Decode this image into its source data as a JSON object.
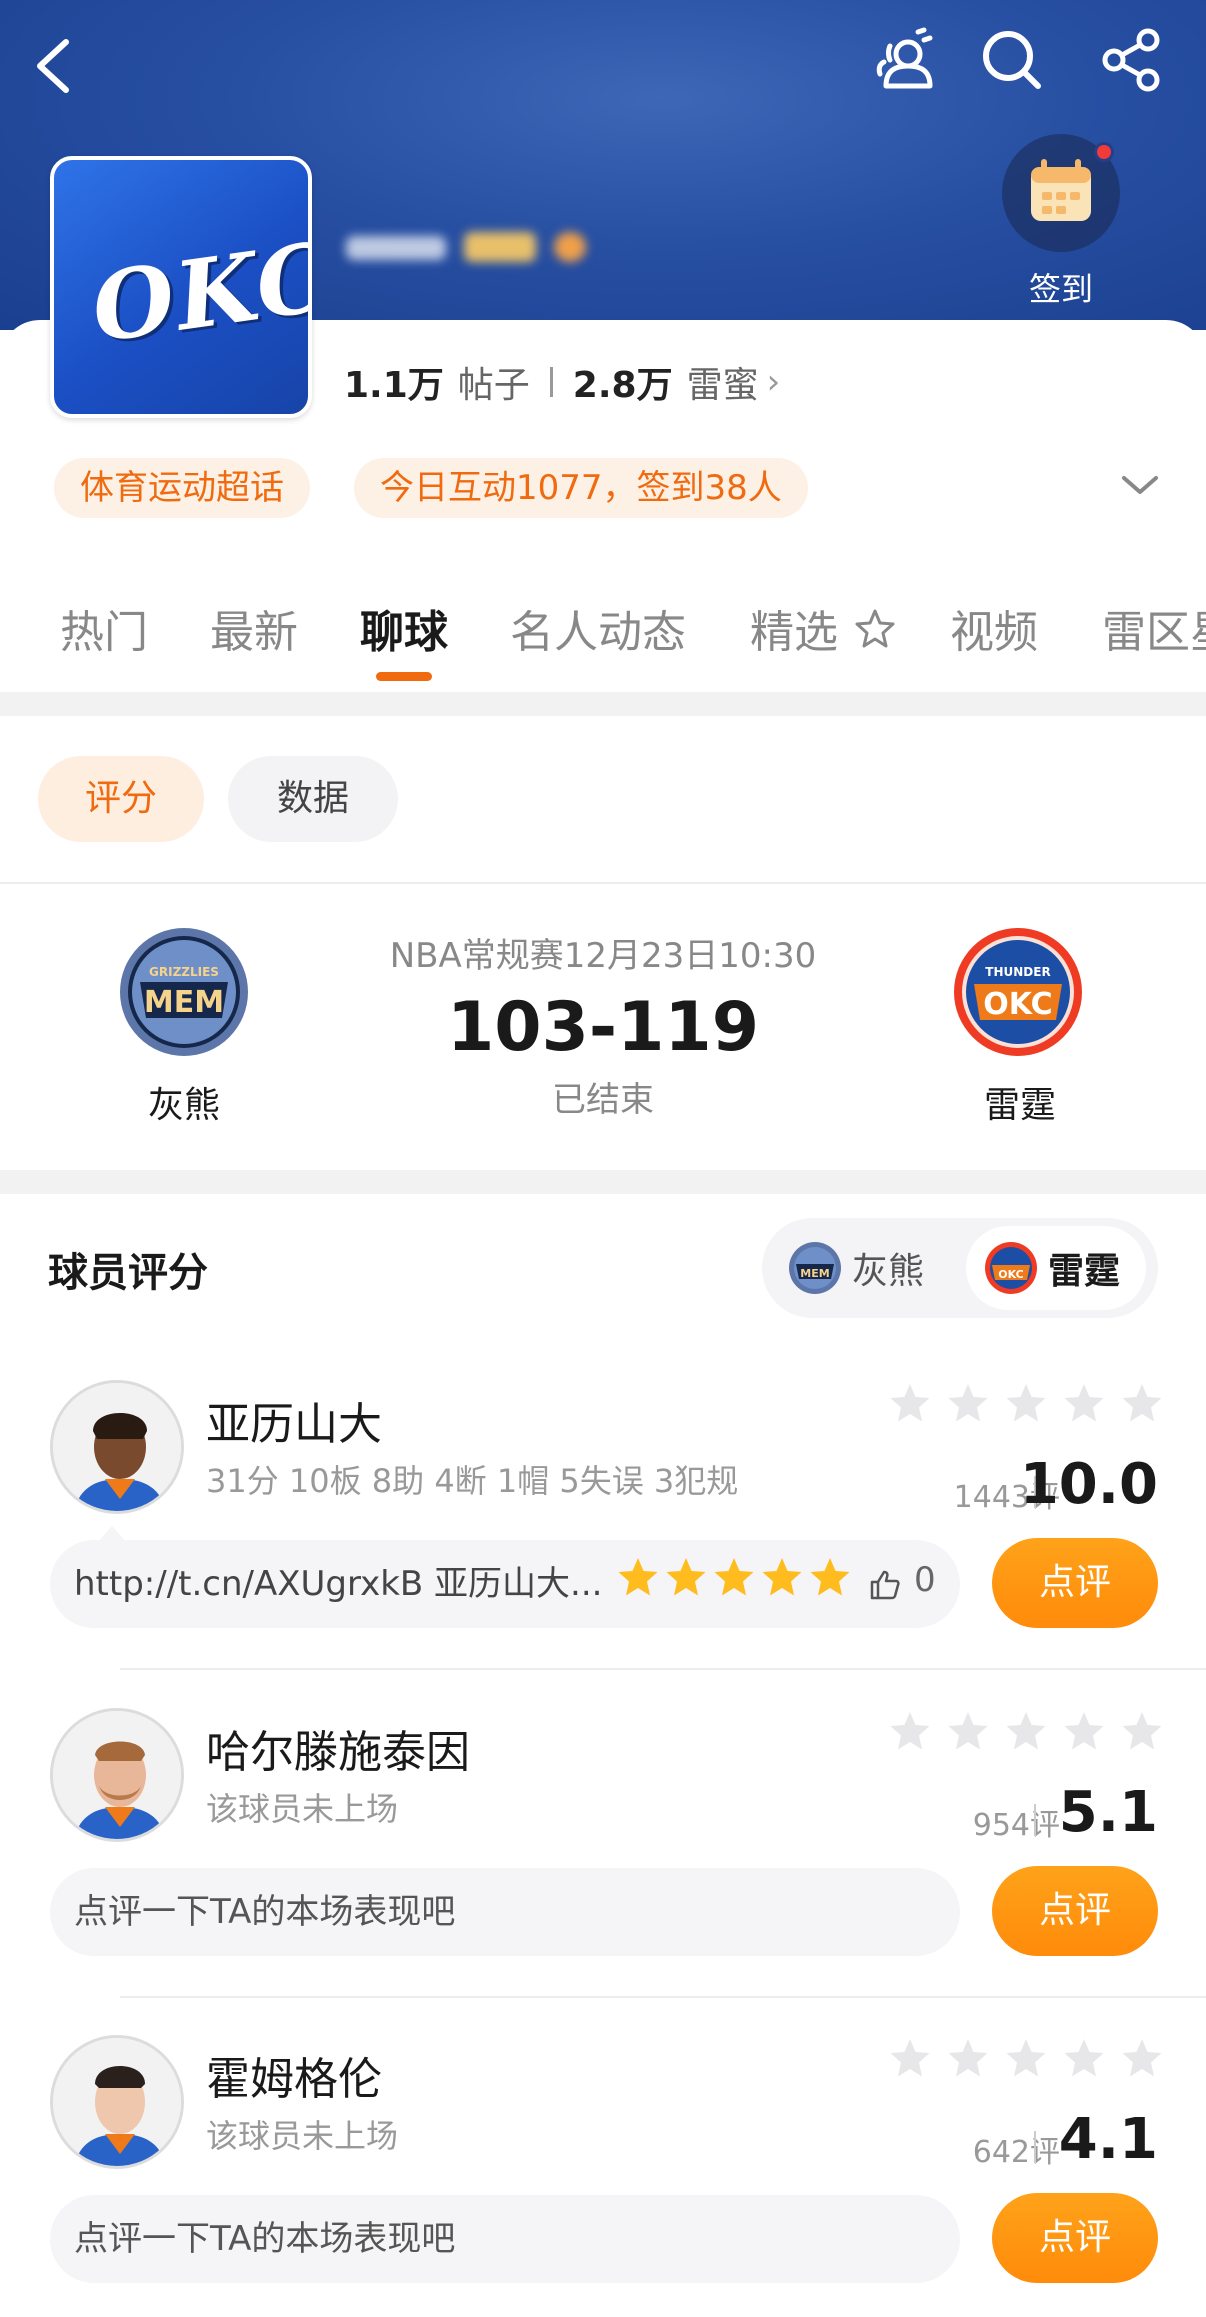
{
  "header": {
    "checkin_label": "签到"
  },
  "stats": {
    "posts_count": "1.1万",
    "posts_label": "帖子",
    "fans_count": "2.8万",
    "fans_label": "雷蜜"
  },
  "tags": {
    "category": "体育运动超话",
    "activity": "今日互动1077，签到38人"
  },
  "tabs": [
    "热门",
    "最新",
    "聊球",
    "名人动态",
    "精选",
    "视频",
    "雷区星"
  ],
  "subtabs": [
    "评分",
    "数据"
  ],
  "match": {
    "info": "NBA常规赛12月23日10:30",
    "score": "103-119",
    "status": "已结束",
    "home": {
      "name": "灰熊",
      "logo_text": "MEM",
      "logo_top": "GRIZZLIES",
      "color": "#5d76a9"
    },
    "away": {
      "name": "雷霆",
      "logo_text": "OKC",
      "logo_top": "THUNDER",
      "color": "#ef3b24"
    }
  },
  "ratings": {
    "title": "球员评分",
    "team_options": [
      "灰熊",
      "雷霆"
    ],
    "selected_team": "雷霆",
    "players": [
      {
        "name": "亚历山大",
        "stats": "31分 10板 8助 4断 1帽 5失误 3犯规",
        "count": "1443评",
        "score": "10.0",
        "comment": "http://t.cn/AXUgrxkB 亚历山大...",
        "comment_stars": 5,
        "likes": "0",
        "button": "点评"
      },
      {
        "name": "哈尔滕施泰因",
        "stats": "该球员未上场",
        "count": "954评",
        "score": "5.1",
        "comment": "点评一下TA的本场表现吧",
        "button": "点评"
      },
      {
        "name": "霍姆格伦",
        "stats": "该球员未上场",
        "count": "642评",
        "score": "4.1",
        "comment": "点评一下TA的本场表现吧",
        "button": "点评"
      }
    ]
  },
  "colors": {
    "accent": "#f06a0f",
    "header_blue": "#274fa2",
    "button_orange": "#ff9410"
  }
}
